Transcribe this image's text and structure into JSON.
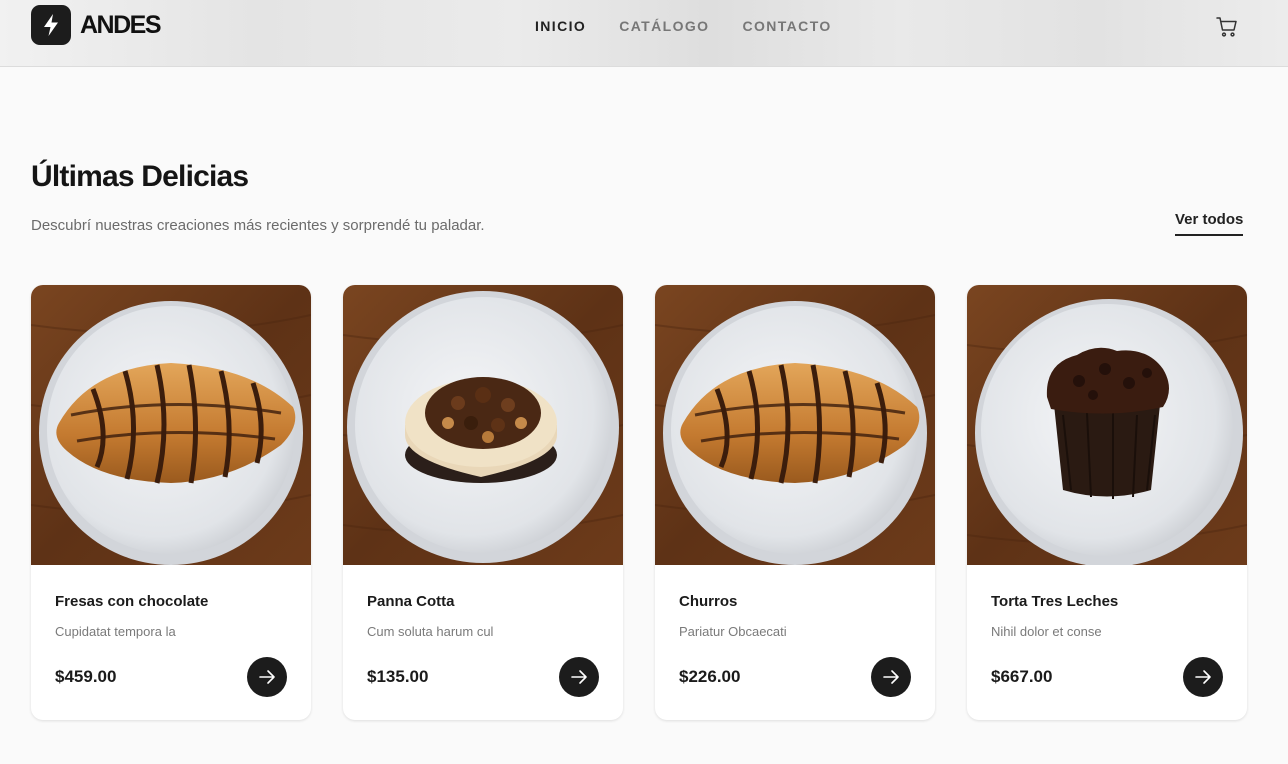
{
  "header": {
    "brand": "ANDES",
    "nav": [
      {
        "label": "INICIO",
        "active": true
      },
      {
        "label": "CATÁLOGO",
        "active": false
      },
      {
        "label": "CONTACTO",
        "active": false
      }
    ],
    "icons": {
      "logo": "lightning-bolt-icon",
      "cart": "cart-icon"
    }
  },
  "section": {
    "title": "Últimas Delicias",
    "subtitle": "Descubrí nuestras creaciones más recientes y sorprendé tu paladar.",
    "view_all": "Ver todos"
  },
  "products": [
    {
      "name": "Fresas con chocolate",
      "desc": "Cupidatat tempora la",
      "price": "$459.00",
      "image": "croissant"
    },
    {
      "name": "Panna Cotta",
      "desc": "Cum soluta harum cul",
      "price": "$135.00",
      "image": "cheesecake"
    },
    {
      "name": "Churros",
      "desc": "Pariatur Obcaecati",
      "price": "$226.00",
      "image": "croissant"
    },
    {
      "name": "Torta Tres Leches",
      "desc": "Nihil dolor et conse",
      "price": "$667.00",
      "image": "muffin"
    }
  ],
  "colors": {
    "accent": "#1c1c1c",
    "background": "#fafafa",
    "muted_text": "#6b6b6b",
    "wood": "#6b3c1c",
    "plate": "#e7e9ec"
  }
}
